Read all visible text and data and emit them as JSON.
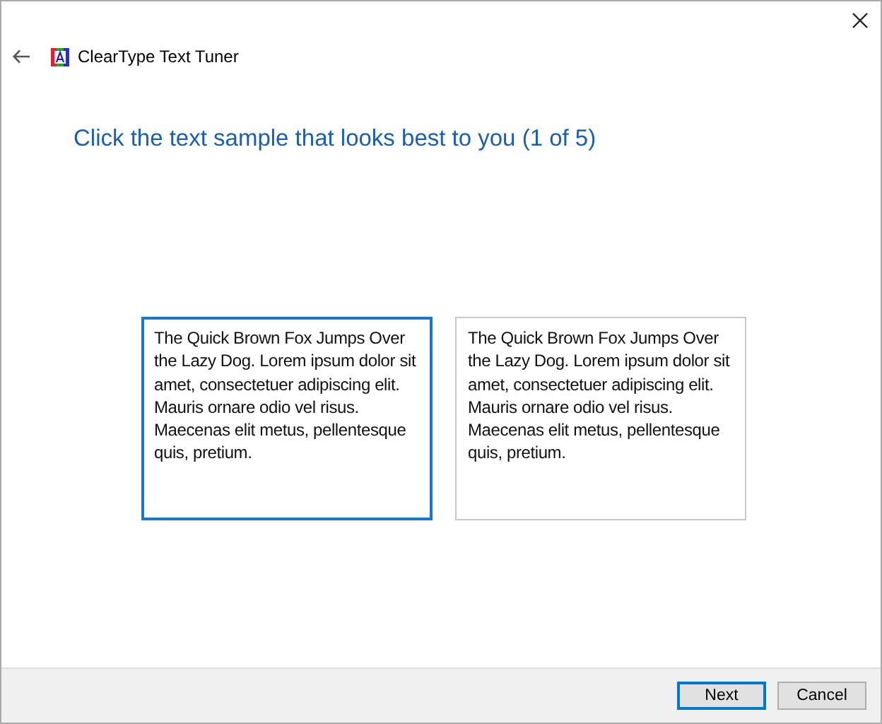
{
  "window": {
    "title": "ClearType Text Tuner"
  },
  "heading": "Click the text sample that looks best to you (1 of 5)",
  "samples": [
    {
      "text": "The Quick Brown Fox Jumps Over the Lazy Dog. Lorem ipsum dolor sit amet, consectetuer adipiscing elit. Mauris ornare odio vel risus. Maecenas elit metus, pellentesque quis, pretium.",
      "selected": true
    },
    {
      "text": "The Quick Brown Fox Jumps Over the Lazy Dog. Lorem ipsum dolor sit amet, consectetuer adipiscing elit. Mauris ornare odio vel risus. Maecenas elit metus, pellentesque quis, pretium.",
      "selected": false
    }
  ],
  "buttons": [
    {
      "label": "Next",
      "default": true
    },
    {
      "label": "Cancel",
      "default": false
    }
  ]
}
